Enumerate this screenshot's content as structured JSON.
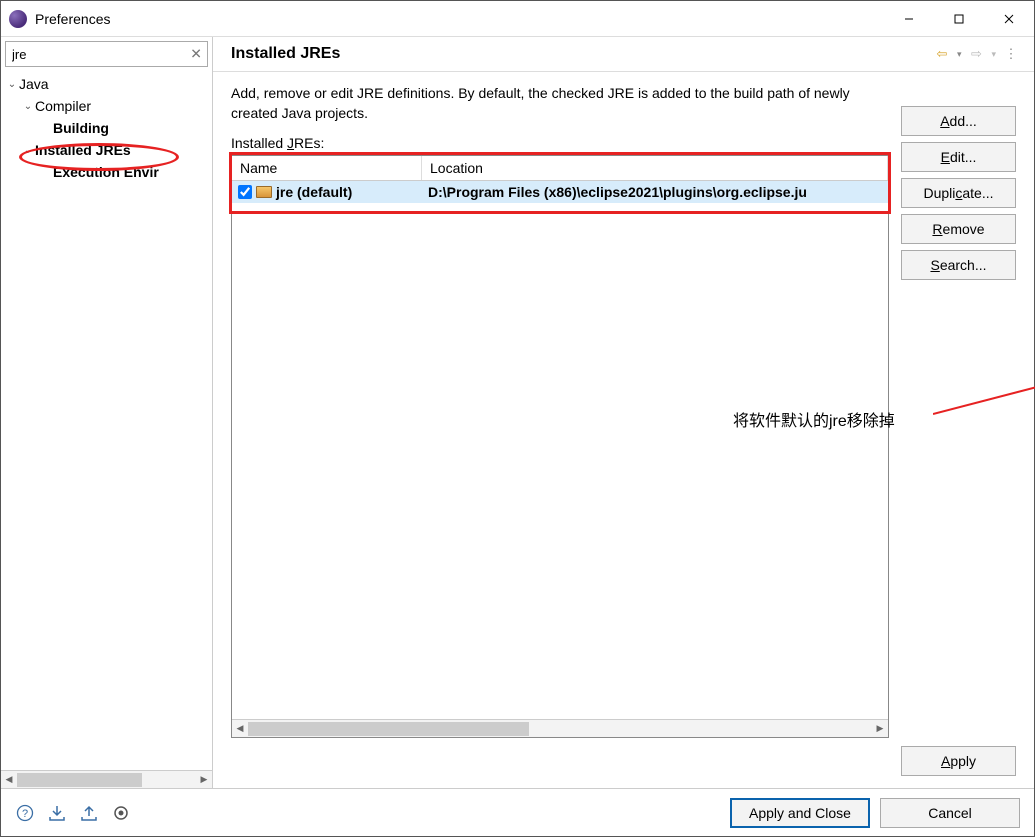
{
  "window": {
    "title": "Preferences"
  },
  "filter": {
    "value": "jre",
    "placeholder": "type filter text"
  },
  "tree": {
    "java": "Java",
    "compiler": "Compiler",
    "building": "Building",
    "installedJres": "Installed JREs",
    "executionEnv": "Execution Envir"
  },
  "page": {
    "title": "Installed JREs",
    "description": "Add, remove or edit JRE definitions. By default, the checked JRE is added to the build path of newly created Java projects.",
    "listLabel": "Installed JREs:"
  },
  "columns": {
    "name": "Name",
    "location": "Location"
  },
  "jres": [
    {
      "checked": true,
      "name": "jre (default)",
      "location": "D:\\Program Files (x86)\\eclipse2021\\plugins\\org.eclipse.ju"
    }
  ],
  "buttons": {
    "add": "Add...",
    "edit": "Edit...",
    "duplicate": "Duplicate...",
    "remove": "Remove",
    "search": "Search...",
    "apply": "Apply",
    "applyClose": "Apply and Close",
    "cancel": "Cancel"
  },
  "annotation": {
    "text": "将软件默认的jre移除掉"
  }
}
